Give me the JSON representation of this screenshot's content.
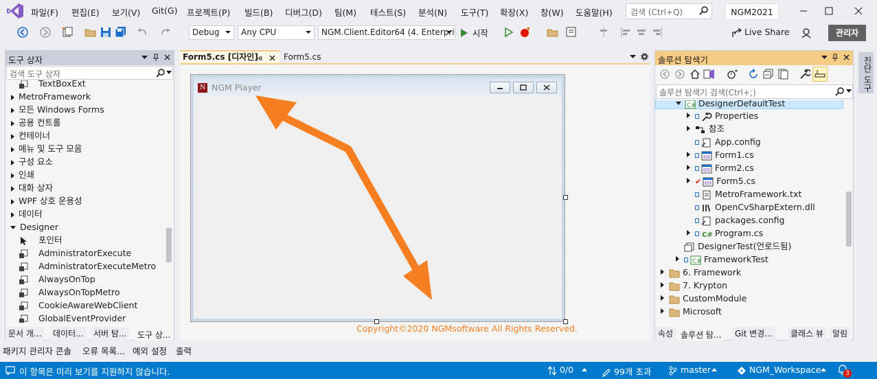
{
  "menu": [
    "파일(F)",
    "편집(E)",
    "보기(V)",
    "Git(G)",
    "프로젝트(P)",
    "빌드(B)",
    "디버그(D)",
    "팀(M)",
    "테스트(S)",
    "분석(N)",
    "도구(T)",
    "확장(X)",
    "창(W)",
    "도움말(H)"
  ],
  "search": {
    "placeholder": "검색 (Ctrl+Q)"
  },
  "solution_name": "NGM2021",
  "toolbar": {
    "config": "Debug",
    "platform": "Any CPU",
    "startup_project": "NGM.Client.Editor64 (4. Enterprise",
    "start_label": "시작",
    "live_share": "Live Share",
    "admin": "관리자"
  },
  "toolbox": {
    "title": "도구 상자",
    "search_placeholder": "검색 도구 상자",
    "items": [
      {
        "label": "TextBoxExt",
        "kind": "control"
      },
      {
        "label": "MetroFramework",
        "kind": "group"
      },
      {
        "label": "모든 Windows Forms",
        "kind": "group"
      },
      {
        "label": "공용 컨트롤",
        "kind": "group"
      },
      {
        "label": "컨테이너",
        "kind": "group"
      },
      {
        "label": "메뉴 및 도구 모음",
        "kind": "group"
      },
      {
        "label": "구성 요소",
        "kind": "group"
      },
      {
        "label": "인쇄",
        "kind": "group"
      },
      {
        "label": "대화 상자",
        "kind": "group"
      },
      {
        "label": "WPF 상호 운용성",
        "kind": "group"
      },
      {
        "label": "데이터",
        "kind": "group"
      },
      {
        "label": "Designer",
        "kind": "open"
      },
      {
        "label": "포인터",
        "kind": "pointer"
      },
      {
        "label": "AdministratorExecute",
        "kind": "control"
      },
      {
        "label": "AdministratorExecuteMetro",
        "kind": "control"
      },
      {
        "label": "AlwaysOnTop",
        "kind": "control"
      },
      {
        "label": "AlwaysOnTopMetro",
        "kind": "control"
      },
      {
        "label": "CookieAwareWebClient",
        "kind": "control"
      },
      {
        "label": "GlobalEventProvider",
        "kind": "control"
      }
    ],
    "bottom_tabs": [
      "문서 개...",
      "데이터...",
      "서버 탐...",
      "도구 상..."
    ]
  },
  "document": {
    "tabs": [
      "Form5.cs [디자인]",
      "Form5.cs"
    ],
    "form_title": "NGM Player",
    "form_icon_letter": "N",
    "copyright": "Copyright©2020 NGMsoftware All Rights Reserved."
  },
  "solution_explorer": {
    "title": "솔루션 탐색기",
    "search_placeholder": "솔루션 탐색기 검색(Ctrl+;)",
    "items": [
      {
        "label": "DesignerDefaultTest",
        "indent": 0,
        "expander": "open",
        "icon": "csharp-project",
        "selected": true
      },
      {
        "label": "Properties",
        "indent": 1,
        "expander": "closed",
        "icon": "wrench",
        "lock": true
      },
      {
        "label": "참조",
        "indent": 1,
        "expander": "closed",
        "icon": "references"
      },
      {
        "label": "App.config",
        "indent": 1,
        "expander": "none",
        "icon": "config",
        "lock": true
      },
      {
        "label": "Form1.cs",
        "indent": 1,
        "expander": "closed",
        "icon": "form",
        "lock": true
      },
      {
        "label": "Form2.cs",
        "indent": 1,
        "expander": "closed",
        "icon": "form",
        "lock": true
      },
      {
        "label": "Form5.cs",
        "indent": 1,
        "expander": "closed",
        "icon": "form",
        "check": true
      },
      {
        "label": "MetroFramework.txt",
        "indent": 1,
        "expander": "none",
        "icon": "text",
        "lock": true
      },
      {
        "label": "OpenCvSharpExtern.dll",
        "indent": 1,
        "expander": "none",
        "icon": "dll",
        "lock": true
      },
      {
        "label": "packages.config",
        "indent": 1,
        "expander": "none",
        "icon": "config",
        "lock": true
      },
      {
        "label": "Program.cs",
        "indent": 1,
        "expander": "closed",
        "icon": "csharp",
        "lock": true
      },
      {
        "label": "DesignerTest(언로드됨)",
        "indent": 0,
        "expander": "none",
        "icon": "unloaded"
      },
      {
        "label": "FrameworkTest",
        "indent": 0,
        "expander": "closed",
        "icon": "csharp-project",
        "lock": true
      },
      {
        "label": "6. Framework",
        "indent": -1,
        "expander": "closed",
        "icon": "folder"
      },
      {
        "label": "7. Krypton",
        "indent": -1,
        "expander": "closed",
        "icon": "folder"
      },
      {
        "label": "CustomModule",
        "indent": -1,
        "expander": "closed",
        "icon": "folder"
      },
      {
        "label": "Microsoft",
        "indent": -1,
        "expander": "closed",
        "icon": "folder"
      }
    ],
    "bottom_tabs": [
      "속성",
      "솔루션 탐...",
      "Git 변경...",
      "클래스 뷰",
      "알림"
    ]
  },
  "right_strip": "진단 도구",
  "output_tabs": [
    "패키지 관리자 콘솔",
    "오류 목록...",
    "예외 설정",
    "출력"
  ],
  "status": {
    "message": "이 항목은 미리 보기를 지원하지 않습니다.",
    "sync": "0/0",
    "pending": "99개 초과",
    "branch": "master",
    "repo": "NGM_Workspace",
    "notifications": "3"
  },
  "colors": {
    "accent": "#007acc",
    "highlight": "#f5cc84",
    "arrow": "#f57f20"
  }
}
